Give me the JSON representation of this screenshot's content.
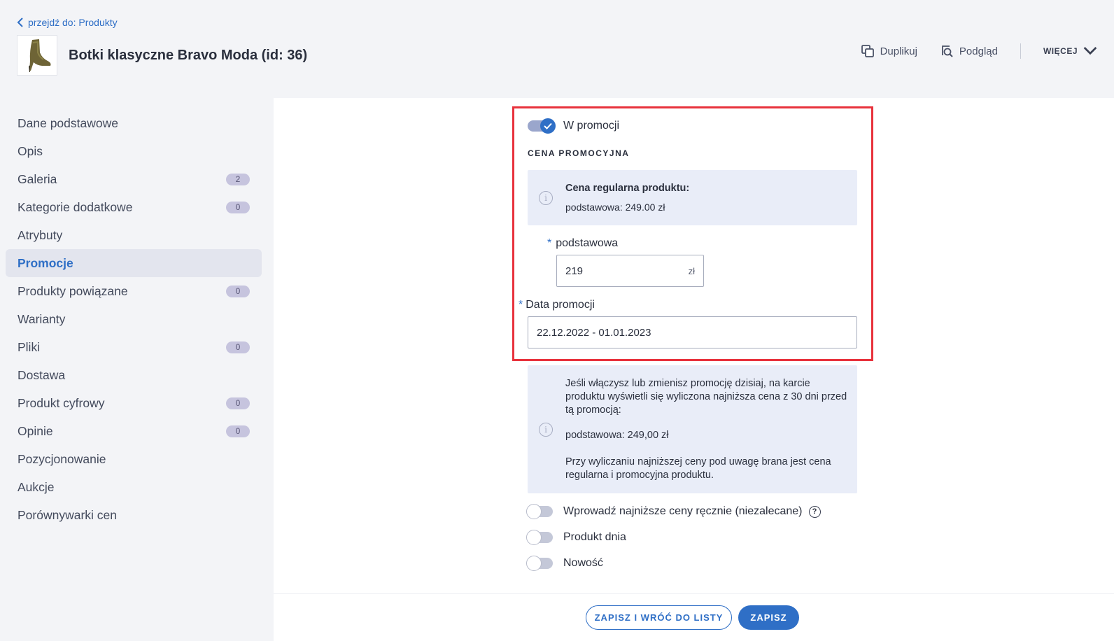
{
  "header": {
    "back_label": "przejdź do: Produkty",
    "product_title": "Botki klasyczne Bravo Moda (id: 36)",
    "actions": {
      "duplicate": "Duplikuj",
      "preview": "Podgląd",
      "more": "WIĘCEJ"
    }
  },
  "sidebar": {
    "items": [
      {
        "label": "Dane podstawowe",
        "badge": null
      },
      {
        "label": "Opis",
        "badge": null
      },
      {
        "label": "Galeria",
        "badge": "2"
      },
      {
        "label": "Kategorie dodatkowe",
        "badge": "0"
      },
      {
        "label": "Atrybuty",
        "badge": null
      },
      {
        "label": "Promocje",
        "badge": null,
        "active": true
      },
      {
        "label": "Produkty powiązane",
        "badge": "0"
      },
      {
        "label": "Warianty",
        "badge": null
      },
      {
        "label": "Pliki",
        "badge": "0"
      },
      {
        "label": "Dostawa",
        "badge": null
      },
      {
        "label": "Produkt cyfrowy",
        "badge": "0"
      },
      {
        "label": "Opinie",
        "badge": "0"
      },
      {
        "label": "Pozycjonowanie",
        "badge": null
      },
      {
        "label": "Aukcje",
        "badge": null
      },
      {
        "label": "Porównywarki cen",
        "badge": null
      }
    ]
  },
  "promo": {
    "toggle_label": "W promocji",
    "toggle_on": true,
    "section_title": "CENA PROMOCYJNA",
    "regular_price_title": "Cena regularna produktu:",
    "regular_price_value": "podstawowa: 249.00 zł",
    "price_label": "podstawowa",
    "price_value": "219",
    "price_suffix": "zł",
    "date_label": "Data promocji",
    "date_value": "22.12.2022 - 01.01.2023",
    "info_line1": "Jeśli włączysz lub zmienisz promocję dzisiaj, na karcie",
    "info_line2": "produktu wyświetli się wyliczona najniższa cena z 30 dni przed",
    "info_line3": "tą promocją:",
    "info_lowest": "podstawowa: 249,00 zł",
    "info_note1": "Przy wyliczaniu najniższej ceny pod uwagę brana jest cena",
    "info_note2": "regularna i promocyjna produktu."
  },
  "options": {
    "manual_lowest": "Wprowadź najniższe ceny ręcznie (niezalecane)",
    "product_of_day": "Produkt dnia",
    "new": "Nowość"
  },
  "footer": {
    "save_return": "ZAPISZ I WRÓĆ DO LISTY",
    "save": "ZAPISZ"
  },
  "colors": {
    "accent": "#2f6fc6",
    "highlight": "#e8323c"
  }
}
